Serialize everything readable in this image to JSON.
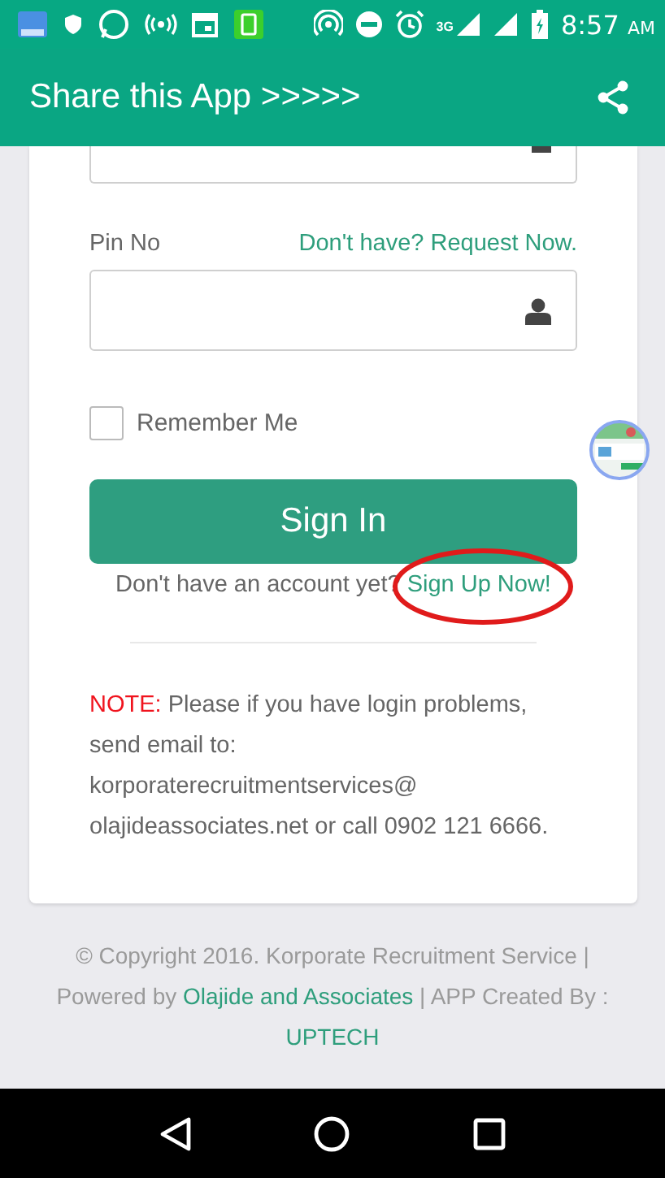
{
  "status_bar": {
    "network": "3G",
    "time": "8:57",
    "period": "AM"
  },
  "app_bar": {
    "title": "Share this App >>>>>"
  },
  "form": {
    "pin_label": "Pin No",
    "pin_link": "Don't have? Request Now.",
    "remember": {
      "label": "Remember Me",
      "checked": false
    },
    "sign_in": "Sign In",
    "signup_prompt": "Don't have an account yet?",
    "signup_link": "Sign Up Now!",
    "signup_circled": true,
    "note_label": "NOTE:",
    "note_lines": [
      "Please if you have login problems,",
      "send email to:",
      "korporaterecruitmentservices@",
      "olajideassociates.net or call 0902 121 6666."
    ]
  },
  "footer": {
    "line1": "© Copyright 2016. Korporate Recruitment Service |",
    "powered": "Powered by",
    "link1": "Olajide and Associates",
    "created": "| APP Created By :",
    "link2": "UPTECH"
  }
}
